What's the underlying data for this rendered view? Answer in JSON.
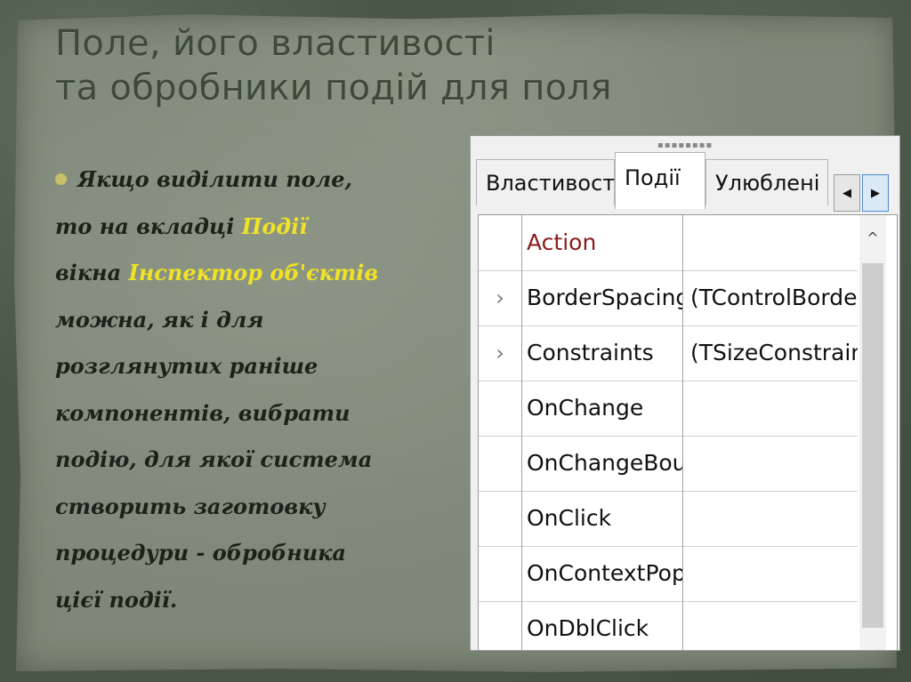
{
  "slide": {
    "title_line1": "Поле, його властивості",
    "title_line2": "та обробники подій для поля",
    "text": {
      "l1": "Якщо виділити поле,",
      "l2a": "то на вкладці ",
      "l2b": "Події",
      "l3a": "вікна ",
      "l3b": "Інспектор об'єктів",
      "l4": "можна, як і для",
      "l5": "розглянутих раніше",
      "l6": "компонентів, вибрати",
      "l7": "подію, для якої система",
      "l8": "створить заготовку",
      "l9": "процедури - обробника",
      "l10": "цієї події."
    },
    "highlight_color": "#f0e226"
  },
  "inspector": {
    "tabs": {
      "properties": "Властивості",
      "events": "Події",
      "favorites": "Улюблені"
    },
    "rows": [
      {
        "expand": "",
        "name": "Action",
        "value": ""
      },
      {
        "expand": "›",
        "name": "BorderSpacing",
        "value": "(TControlBorderS"
      },
      {
        "expand": "›",
        "name": "Constraints",
        "value": "(TSizeConstraints"
      },
      {
        "expand": "",
        "name": "OnChange",
        "value": ""
      },
      {
        "expand": "",
        "name": "OnChangeBoun",
        "value": ""
      },
      {
        "expand": "",
        "name": "OnClick",
        "value": ""
      },
      {
        "expand": "",
        "name": "OnContextPopu",
        "value": ""
      },
      {
        "expand": "",
        "name": "OnDblClick",
        "value": ""
      }
    ]
  }
}
